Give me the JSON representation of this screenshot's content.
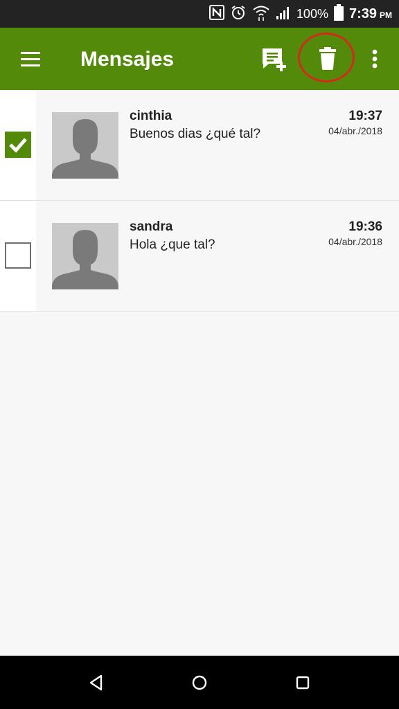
{
  "status_bar": {
    "battery_percent": "100%",
    "time": "7:39",
    "ampm": "PM",
    "icons": [
      "nfc-icon",
      "alarm-icon",
      "wifi-icon",
      "signal-icon",
      "battery-icon"
    ]
  },
  "toolbar": {
    "title": "Mensajes",
    "background_color": "#548a09",
    "icons": {
      "menu": "hamburger-menu-icon",
      "new_message": "new-message-icon",
      "delete": "trash-icon",
      "more": "more-vert-icon"
    },
    "annotation_color": "#d42a1d"
  },
  "messages": [
    {
      "name": "cinthia",
      "preview": "Buenos dias ¿qué tal?",
      "time": "19:37",
      "date": "04/abr./2018",
      "selected": true
    },
    {
      "name": "sandra",
      "preview": "Hola ¿que tal?",
      "time": "19:36",
      "date": "04/abr./2018",
      "selected": false
    }
  ],
  "nav_bar": {
    "icons": [
      "back-icon",
      "home-icon",
      "recents-icon"
    ]
  }
}
